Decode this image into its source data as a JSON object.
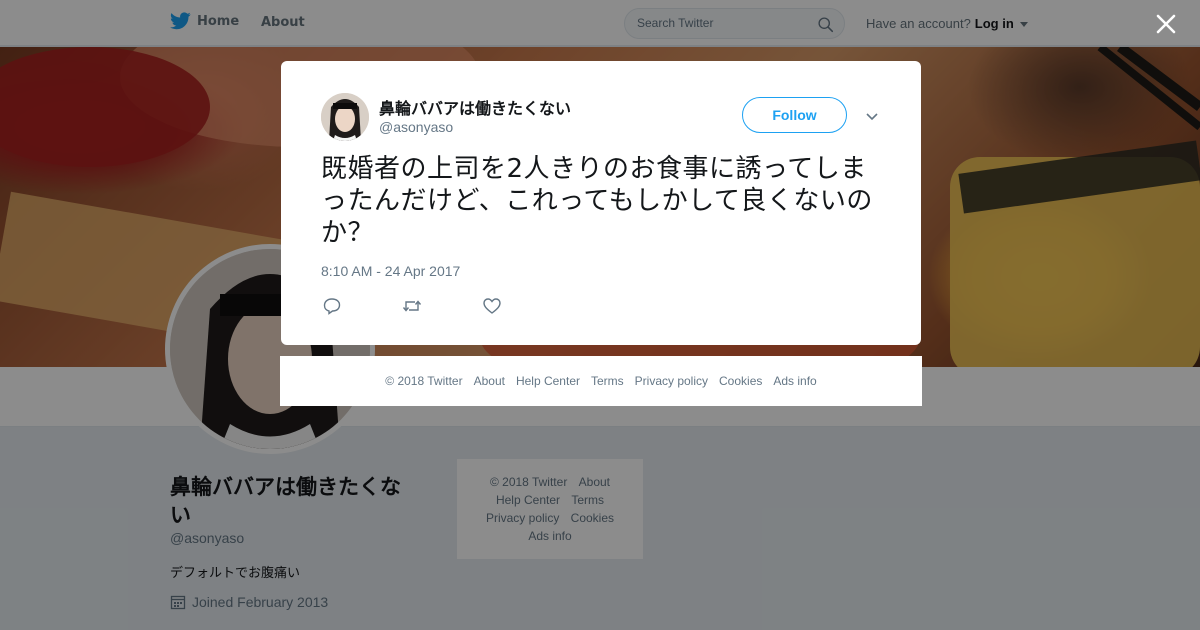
{
  "nav": {
    "home_label": "Home",
    "about_label": "About",
    "search_placeholder": "Search Twitter",
    "account_prompt": "Have an account?",
    "login_label": "Log in"
  },
  "profile": {
    "name": "鼻輪ババアは働きたくない",
    "handle": "@asonyaso",
    "bio": "デフォルトでお腹痛い",
    "joined": "Joined February 2013"
  },
  "side_footer": {
    "copyright": "© 2018 Twitter",
    "about": "About",
    "help": "Help Center",
    "terms": "Terms",
    "privacy": "Privacy policy",
    "cookies": "Cookies",
    "ads": "Ads info"
  },
  "tweet": {
    "author_name": "鼻輪ババアは働きたくない",
    "author_handle": "@asonyaso",
    "follow_label": "Follow",
    "text": "既婚者の上司を2人きりのお食事に誘ってしまったんだけど、これってもしかして良くないのか？",
    "timestamp": "8:10 AM - 24 Apr 2017"
  },
  "modal_footer": {
    "copyright": "© 2018 Twitter",
    "about": "About",
    "help": "Help Center",
    "terms": "Terms",
    "privacy": "Privacy policy",
    "cookies": "Cookies",
    "ads": "Ads info"
  },
  "colors": {
    "twitter_blue": "#1da1f2",
    "secondary_text": "#657786",
    "background": "#e6ecf0"
  },
  "icons": [
    "twitter-bird-icon",
    "search-icon",
    "caret-down-icon",
    "close-icon",
    "chevron-down-icon",
    "reply-icon",
    "retweet-icon",
    "like-icon",
    "calendar-icon"
  ]
}
